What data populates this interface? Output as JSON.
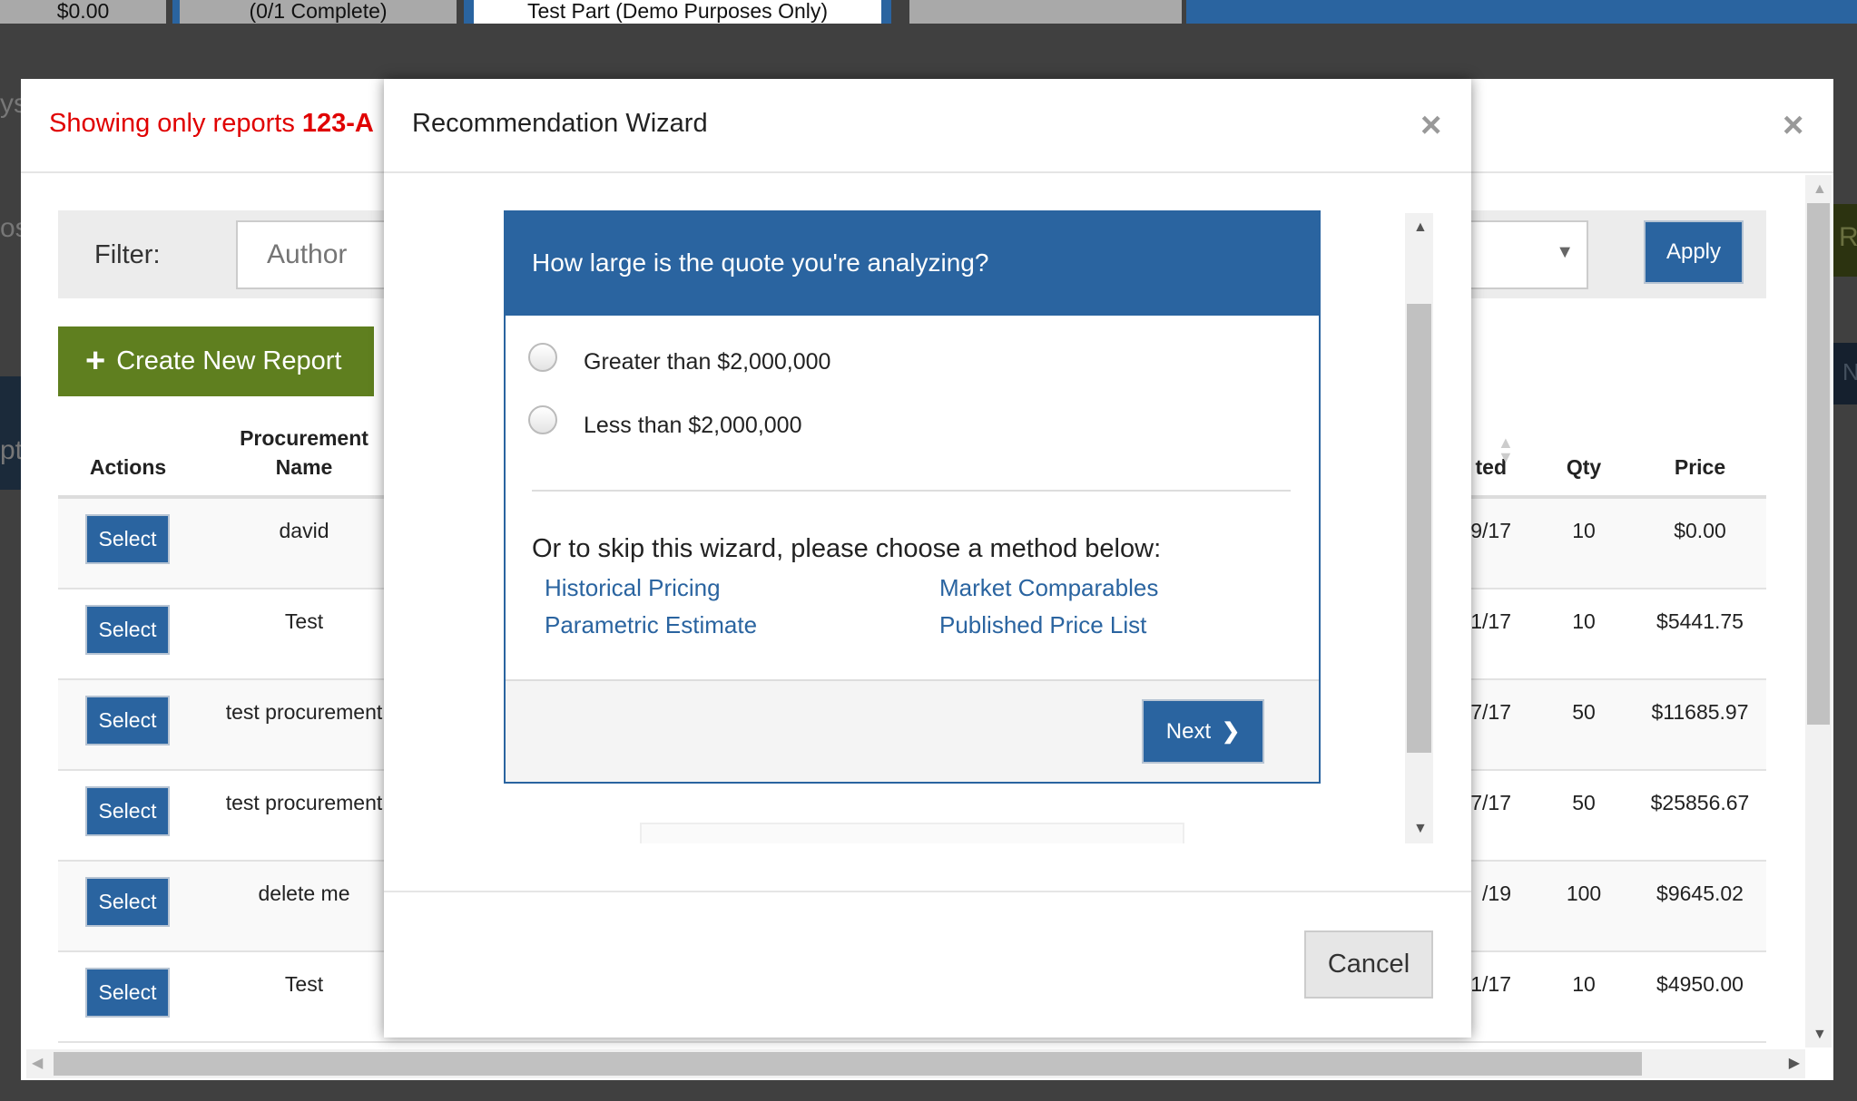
{
  "background": {
    "tabs": [
      "$0.00",
      "(0/1 Complete)",
      "Test Part (Demo Purposes Only)",
      ""
    ],
    "fragments": [
      "ys",
      "os",
      "pt",
      "R",
      "N"
    ]
  },
  "reports_modal": {
    "title_prefix": "Showing only reports ",
    "title_highlight": "123-A",
    "close_icon": "×",
    "filter": {
      "label": "Filter:",
      "author_placeholder": "Author",
      "select_value": "",
      "apply_label": "Apply"
    },
    "create_button": {
      "icon": "plus-icon",
      "label": "Create New Report"
    },
    "columns": {
      "actions": "Actions",
      "procurement_line1": "Procurement",
      "procurement_line2": "Name",
      "date_partial": "ted",
      "qty": "Qty",
      "price": "Price"
    },
    "rows": [
      {
        "action": "Select",
        "name": "david",
        "date": "9/17",
        "qty": "10",
        "price": "$0.00"
      },
      {
        "action": "Select",
        "name": "Test",
        "date": "1/17",
        "qty": "10",
        "price": "$5441.75"
      },
      {
        "action": "Select",
        "name": "test procurement",
        "date": "7/17",
        "qty": "50",
        "price": "$11685.97"
      },
      {
        "action": "Select",
        "name": "test procurement",
        "date": "7/17",
        "qty": "50",
        "price": "$25856.67"
      },
      {
        "action": "Select",
        "name": "delete me",
        "date": "/19",
        "qty": "100",
        "price": "$9645.02"
      },
      {
        "action": "Select",
        "name": "Test",
        "date": "1/17",
        "qty": "10",
        "price": "$4950.00"
      }
    ]
  },
  "wizard": {
    "title": "Recommendation Wizard",
    "close_icon": "×",
    "question": "How large is the quote you're analyzing?",
    "options": [
      "Greater than $2,000,000",
      "Less than $2,000,000"
    ],
    "skip_text": "Or to skip this wizard, please choose a method below:",
    "methods": [
      "Historical Pricing",
      "Market Comparables",
      "Parametric Estimate",
      "Published Price List"
    ],
    "next_label": "Next",
    "cancel_label": "Cancel"
  },
  "colors": {
    "primary": "#2a64a0",
    "success": "#5f7f1f",
    "alert": "#e00000"
  }
}
